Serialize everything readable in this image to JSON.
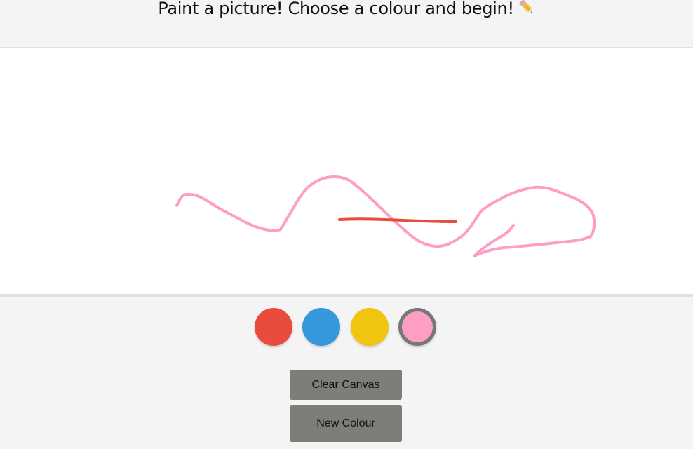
{
  "header": {
    "title": "Paint a picture! Choose a colour and begin!",
    "title_icon": "pencil-icon"
  },
  "canvas": {
    "background": "#ffffff",
    "strokes": [
      {
        "color": "#ff9ec4",
        "name": "pink-stroke"
      },
      {
        "color": "#e74c3c",
        "name": "red-stroke"
      }
    ]
  },
  "palette": {
    "colors": [
      {
        "name": "red",
        "hex": "#e74c3c"
      },
      {
        "name": "blue",
        "hex": "#3498db"
      },
      {
        "name": "yellow",
        "hex": "#f1c40f"
      },
      {
        "name": "pink",
        "hex": "#ff9ec4"
      }
    ],
    "selected": "pink"
  },
  "buttons": {
    "clear_label": "Clear Canvas",
    "new_colour_label": "New Colour"
  }
}
